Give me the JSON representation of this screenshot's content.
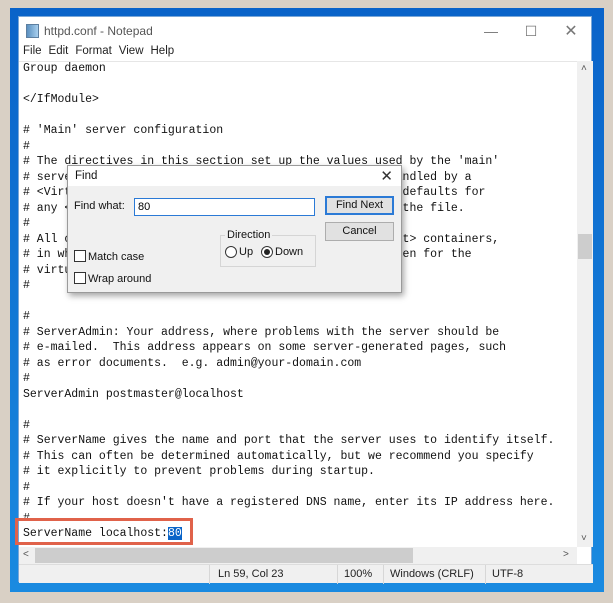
{
  "window": {
    "title": "httpd.conf - Notepad",
    "minimize_icon": "minimize-icon",
    "maximize_icon": "maximize-icon",
    "close_icon": "close-icon"
  },
  "menu": [
    "File",
    "Edit",
    "Format",
    "View",
    "Help"
  ],
  "editor": {
    "lines": [
      "Group daemon",
      "",
      "</IfModule>",
      "",
      "# 'Main' server configuration",
      "#",
      "# The directives in this section set up the values used by the 'main'",
      "# server, which responds to any requests that aren't handled by a",
      "# <VirtualHost> definition.  These values also provide defaults for",
      "# any <VirtualHost> containers you may define later in the file.",
      "#",
      "# All of these directives may appear inside <VirtualHost> containers,",
      "# in which case these default settings will be overridden for the",
      "# virtual host being defined.",
      "#",
      "",
      "#",
      "# ServerAdmin: Your address, where problems with the server should be",
      "# e-mailed.  This address appears on some server-generated pages, such",
      "# as error documents.  e.g. admin@your-domain.com",
      "#",
      "ServerAdmin postmaster@localhost",
      "",
      "#",
      "# ServerName gives the name and port that the server uses to identify itself.",
      "# This can often be determined automatically, but we recommend you specify",
      "# it explicitly to prevent problems during startup.",
      "#",
      "# If your host doesn't have a registered DNS name, enter its IP address here.",
      "#"
    ],
    "last_line_prefix": "ServerName localhost:",
    "selected_text": "80",
    "selection_color": "#0a64c8",
    "highlight_color": "#e0624a"
  },
  "status": {
    "position": "Ln 59, Col 23",
    "zoom": "100%",
    "line_ending": "Windows (CRLF)",
    "encoding": "UTF-8"
  },
  "find_dialog": {
    "title": "Find",
    "find_what_label": "Find what:",
    "find_what_value": "80",
    "find_next": "Find Next",
    "cancel": "Cancel",
    "direction_label": "Direction",
    "up": "Up",
    "down": "Down",
    "direction_selected": "Down",
    "match_case": "Match case",
    "match_case_checked": false,
    "wrap_around": "Wrap around",
    "wrap_around_checked": false
  }
}
